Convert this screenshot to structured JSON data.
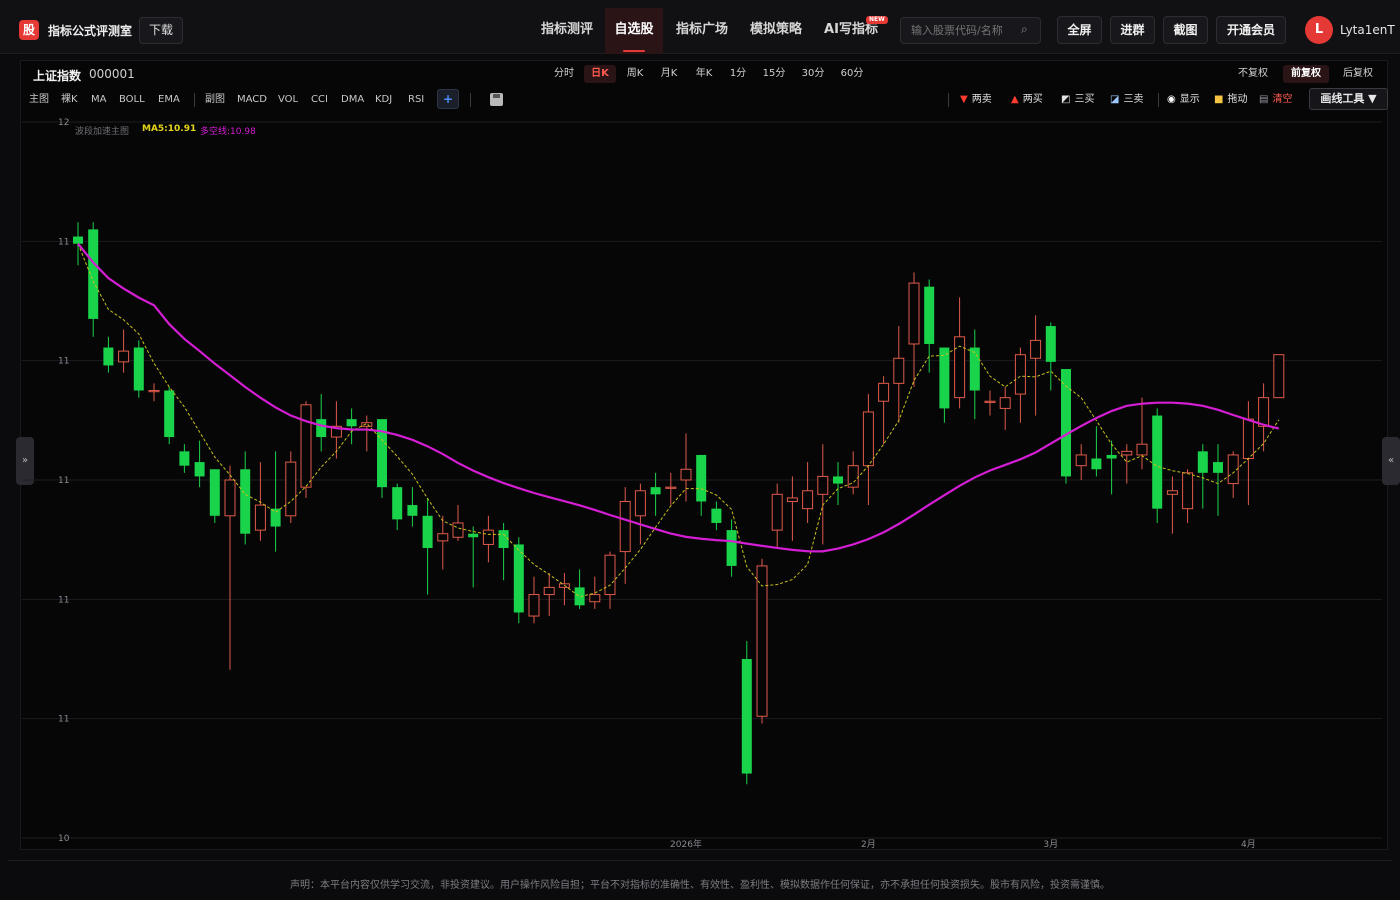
{
  "header": {
    "logo_char": "股",
    "brand": "指标公式评测室",
    "download": "下载",
    "nav": [
      {
        "label": "指标测评",
        "active": false
      },
      {
        "label": "自选股",
        "active": true
      },
      {
        "label": "指标广场",
        "active": false
      },
      {
        "label": "模拟策略",
        "active": false
      },
      {
        "label": "AI写指标",
        "active": false
      }
    ],
    "new_badge": "NEW",
    "search_placeholder": "输入股票代码/名称",
    "search_icon": "search-icon",
    "buttons": [
      "全屏",
      "进群",
      "截图",
      "开通会员"
    ],
    "avatar_letter": "L",
    "username": "Lyta1enT"
  },
  "stock": {
    "name": "上证指数",
    "code": "000001"
  },
  "periods": [
    "分时",
    "日K",
    "周K",
    "月K",
    "年K",
    "1分",
    "15分",
    "30分",
    "60分"
  ],
  "active_period": "日K",
  "adjust": [
    "不复权",
    "前复权",
    "后复权"
  ],
  "active_adjust": "前复权",
  "indicators": [
    "主图",
    "裸K",
    "MA",
    "BOLL",
    "EMA",
    "副图",
    "MACD",
    "VOL",
    "CCI",
    "DMA",
    "KDJ",
    "RSI"
  ],
  "tools": [
    {
      "label": "两卖",
      "icon": "down-triangle-icon"
    },
    {
      "label": "两买",
      "icon": "up-triangle-icon"
    },
    {
      "label": "三买",
      "icon": "trend-up-icon"
    },
    {
      "label": "三卖",
      "icon": "trend-down-icon"
    },
    {
      "label": "显示",
      "icon": "eye-icon"
    },
    {
      "label": "拖动",
      "icon": "lock-icon"
    },
    {
      "label": "清空",
      "icon": "trash-icon"
    }
  ],
  "draw_tools": "画线工具 ▼",
  "legend": {
    "main": "波段加速主图",
    "ma5": "MA5:10.91",
    "dkx": "多空线:10.98"
  },
  "colors": {
    "up": "#e05a4a",
    "down": "#19d44a",
    "ma5": "#c8c01e",
    "dkx": "#d41ed4",
    "accent": "#e53935"
  },
  "chart_data": {
    "type": "candlestick",
    "ylim": [
      10.0,
      12.0
    ],
    "y_ticks": [
      "12",
      "11",
      "11",
      "11",
      "11",
      "11",
      "10"
    ],
    "x_ticks": [
      "2026年",
      "2月",
      "3月",
      "4月"
    ],
    "x_tick_index": [
      40,
      52,
      64,
      77
    ],
    "candles": [
      [
        11.68,
        11.66,
        11.72,
        11.6
      ],
      [
        11.7,
        11.45,
        11.72,
        11.4
      ],
      [
        11.37,
        11.32,
        11.4,
        11.3
      ],
      [
        11.33,
        11.36,
        11.42,
        11.3
      ],
      [
        11.37,
        11.25,
        11.39,
        11.23
      ],
      [
        11.25,
        11.25,
        11.27,
        11.22
      ],
      [
        11.25,
        11.12,
        11.26,
        11.1
      ],
      [
        11.08,
        11.04,
        11.1,
        11.02
      ],
      [
        11.05,
        11.01,
        11.11,
        10.98
      ],
      [
        11.03,
        10.9,
        11.03,
        10.88
      ],
      [
        10.9,
        11.0,
        11.04,
        10.47
      ],
      [
        11.03,
        10.85,
        11.08,
        10.82
      ],
      [
        10.86,
        10.93,
        11.05,
        10.83
      ],
      [
        10.92,
        10.87,
        11.08,
        10.8
      ],
      [
        10.9,
        11.05,
        11.08,
        10.88
      ],
      [
        10.98,
        11.21,
        11.22,
        10.95
      ],
      [
        11.17,
        11.12,
        11.24,
        11.08
      ],
      [
        11.12,
        11.15,
        11.22,
        11.06
      ],
      [
        11.17,
        11.15,
        11.2,
        11.1
      ],
      [
        11.15,
        11.16,
        11.18,
        11.08
      ],
      [
        11.17,
        10.98,
        11.17,
        10.95
      ],
      [
        10.98,
        10.89,
        10.99,
        10.86
      ],
      [
        10.93,
        10.9,
        10.98,
        10.87
      ],
      [
        10.9,
        10.81,
        10.95,
        10.68
      ],
      [
        10.83,
        10.85,
        10.9,
        10.75
      ],
      [
        10.84,
        10.88,
        10.93,
        10.83
      ],
      [
        10.85,
        10.84,
        10.87,
        10.7
      ],
      [
        10.82,
        10.86,
        10.9,
        10.77
      ],
      [
        10.86,
        10.81,
        10.88,
        10.72
      ],
      [
        10.82,
        10.63,
        10.84,
        10.6
      ],
      [
        10.62,
        10.68,
        10.73,
        10.6
      ],
      [
        10.68,
        10.7,
        10.74,
        10.62
      ],
      [
        10.7,
        10.71,
        10.74,
        10.65
      ],
      [
        10.7,
        10.65,
        10.75,
        10.64
      ],
      [
        10.66,
        10.68,
        10.73,
        10.64
      ],
      [
        10.68,
        10.79,
        10.8,
        10.64
      ],
      [
        10.8,
        10.94,
        10.98,
        10.71
      ],
      [
        10.9,
        10.97,
        10.99,
        10.82
      ],
      [
        10.98,
        10.96,
        11.02,
        10.9
      ],
      [
        10.98,
        10.98,
        11.02,
        10.93
      ],
      [
        11.0,
        11.03,
        11.13,
        10.94
      ],
      [
        11.07,
        10.94,
        11.07,
        10.9
      ],
      [
        10.92,
        10.88,
        10.94,
        10.86
      ],
      [
        10.86,
        10.76,
        10.89,
        10.73
      ],
      [
        10.5,
        10.18,
        10.55,
        10.15
      ],
      [
        10.34,
        10.76,
        10.78,
        10.32
      ],
      [
        10.86,
        10.96,
        10.99,
        10.81
      ],
      [
        10.94,
        10.95,
        11.01,
        10.83
      ],
      [
        10.92,
        10.97,
        11.05,
        10.88
      ],
      [
        10.96,
        11.01,
        11.1,
        10.82
      ],
      [
        11.01,
        10.99,
        11.05,
        10.93
      ],
      [
        10.98,
        11.04,
        11.08,
        10.96
      ],
      [
        11.04,
        11.19,
        11.24,
        10.93
      ],
      [
        11.22,
        11.27,
        11.29,
        11.1
      ],
      [
        11.27,
        11.34,
        11.43,
        11.16
      ],
      [
        11.38,
        11.55,
        11.58,
        11.26
      ],
      [
        11.54,
        11.38,
        11.56,
        11.3
      ],
      [
        11.37,
        11.2,
        11.37,
        11.16
      ],
      [
        11.23,
        11.4,
        11.51,
        11.2
      ],
      [
        11.37,
        11.25,
        11.42,
        11.17
      ],
      [
        11.22,
        11.22,
        11.25,
        11.18
      ],
      [
        11.2,
        11.23,
        11.26,
        11.14
      ],
      [
        11.24,
        11.35,
        11.37,
        11.16
      ],
      [
        11.34,
        11.39,
        11.46,
        11.18
      ],
      [
        11.43,
        11.33,
        11.44,
        11.25
      ],
      [
        11.31,
        11.01,
        11.31,
        10.99
      ],
      [
        11.04,
        11.07,
        11.1,
        11.0
      ],
      [
        11.06,
        11.03,
        11.15,
        11.01
      ],
      [
        11.07,
        11.06,
        11.11,
        10.96
      ],
      [
        11.07,
        11.08,
        11.1,
        10.99
      ],
      [
        11.07,
        11.1,
        11.23,
        11.03
      ],
      [
        11.18,
        10.92,
        11.2,
        10.88
      ],
      [
        10.96,
        10.97,
        11.01,
        10.85
      ],
      [
        10.92,
        11.02,
        11.03,
        10.88
      ],
      [
        11.08,
        11.02,
        11.1,
        10.92
      ],
      [
        11.05,
        11.02,
        11.1,
        10.9
      ],
      [
        10.99,
        11.07,
        11.08,
        10.95
      ],
      [
        11.06,
        11.17,
        11.22,
        10.93
      ],
      [
        11.15,
        11.23,
        11.27,
        11.08
      ],
      [
        11.23,
        11.35,
        11.35,
        11.23
      ]
    ]
  },
  "disclaimer": "声明：本平台内容仅供学习交流，非投资建议。用户操作风险自担；平台不对指标的准确性、有效性、盈利性、模拟数据作任何保证，亦不承担任何投资损失。股市有风险，投资需谨慎。"
}
